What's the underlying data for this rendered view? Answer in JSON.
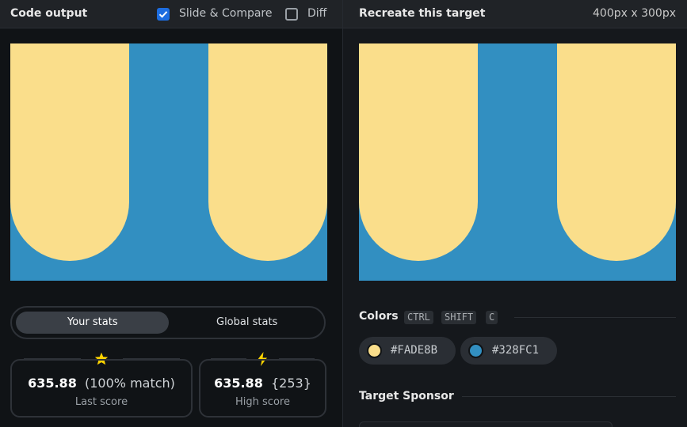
{
  "left_panel": {
    "title": "Code output",
    "slide_compare": {
      "label": "Slide & Compare",
      "checked": true
    },
    "diff": {
      "label": "Diff",
      "checked": false
    }
  },
  "right_panel": {
    "title": "Recreate this target",
    "size": "400px x 300px"
  },
  "stats": {
    "tabs": [
      "Your stats",
      "Global stats"
    ],
    "active_tab": "Your stats",
    "last": {
      "score": "635.88",
      "detail": "(100% match)",
      "label": "Last score",
      "icon": "star-icon"
    },
    "high": {
      "score": "635.88",
      "detail": "{253}",
      "label": "High score",
      "icon": "lightning-icon"
    }
  },
  "colors": {
    "heading": "Colors",
    "shortcut": [
      "CTRL",
      "SHIFT",
      "C"
    ],
    "swatches": [
      {
        "hex": "#FADE8B",
        "color": "#FADE8B"
      },
      {
        "hex": "#328FC1",
        "color": "#328FC1"
      }
    ]
  },
  "sponsor": {
    "heading": "Target Sponsor"
  },
  "palette": {
    "background": "#101316",
    "accent": "#1d6de0",
    "yellow": "#FADE8B",
    "blue": "#328FC1",
    "gold": "#ffd400"
  }
}
